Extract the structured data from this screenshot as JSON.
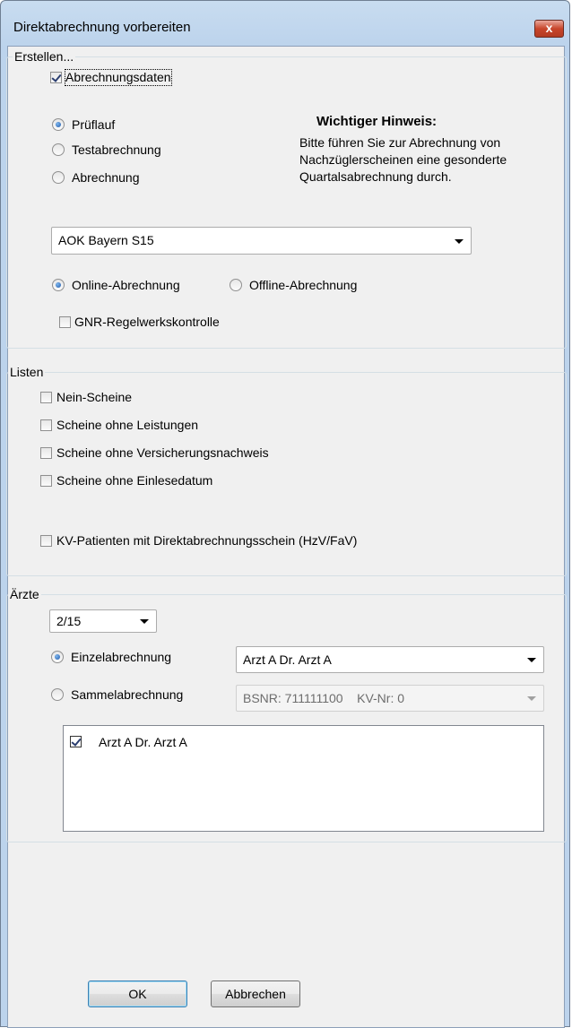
{
  "window": {
    "title": "Direktabrechnung vorbereiten",
    "close_glyph": "x"
  },
  "erstellen": {
    "legend": "Erstellen...",
    "abrechnungsdaten": {
      "label": "Abrechnungsdaten",
      "checked": true
    },
    "modes": [
      {
        "label": "Prüflauf",
        "selected": true
      },
      {
        "label": "Testabrechnung",
        "selected": false
      },
      {
        "label": "Abrechnung",
        "selected": false
      }
    ],
    "hint_title": "Wichtiger Hinweis:",
    "hint_lines": [
      "Bitte führen Sie zur Abrechnung von",
      "Nachzüglerscheinen eine gesonderte",
      "Quartalsabrechnung durch."
    ],
    "kasse_select": "AOK Bayern S15",
    "transfer": [
      {
        "label": "Online-Abrechnung",
        "selected": true
      },
      {
        "label": "Offline-Abrechnung",
        "selected": false
      }
    ],
    "gnr": {
      "label": "GNR-Regelwerkskontrolle",
      "checked": false
    }
  },
  "listen": {
    "legend": "Listen",
    "items": [
      {
        "label": "Nein-Scheine",
        "checked": false
      },
      {
        "label": "Scheine ohne Leistungen",
        "checked": false
      },
      {
        "label": "Scheine ohne Versicherungsnachweis",
        "checked": false
      },
      {
        "label": "Scheine ohne Einlesedatum",
        "checked": false
      },
      {
        "label": "KV-Patienten mit Direktabrechnungsschein (HzV/FaV)",
        "checked": false
      }
    ]
  },
  "aerzte": {
    "legend": "Ärzte",
    "quarter": "2/15",
    "einzel": {
      "label": "Einzelabrechnung",
      "selected": true
    },
    "einzel_select": "Arzt A Dr. Arzt A",
    "sammel": {
      "label": "Sammelabrechnung",
      "selected": false
    },
    "sammel_select": "BSNR: 711111100    KV-Nr: 0",
    "doctors": [
      {
        "label": "Arzt A Dr. Arzt A",
        "checked": true
      }
    ]
  },
  "buttons": {
    "ok": "OK",
    "cancel": "Abbrechen"
  },
  "colors": {
    "title_gradient": "#bcd3ec",
    "client_bg": "#f0f0f0",
    "close_red": "#c8462c"
  }
}
